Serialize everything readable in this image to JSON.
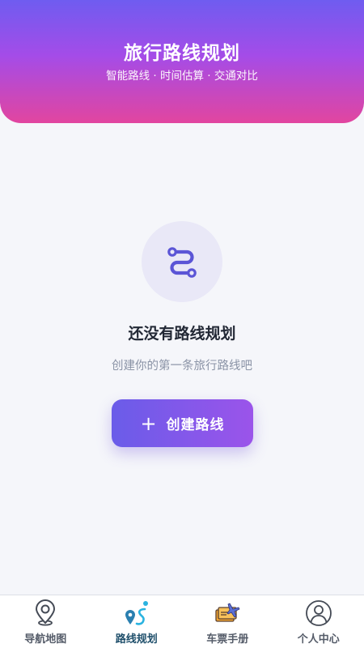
{
  "header": {
    "title": "旅行路线规划",
    "subtitle": "智能路线 · 时间估算 · 交通对比"
  },
  "empty_state": {
    "icon": "route-icon",
    "title": "还没有路线规划",
    "description": "创建你的第一条旅行路线吧"
  },
  "create_button": {
    "icon": "plus-icon",
    "label": "创建路线"
  },
  "tabbar": {
    "active": "路线规划",
    "items": [
      {
        "label": "导航地图",
        "icon": "map-pin-icon"
      },
      {
        "label": "路线规划",
        "icon": "route-pin-icon"
      },
      {
        "label": "车票手册",
        "icon": "ticket-plane-icon"
      },
      {
        "label": "个人中心",
        "icon": "user-icon"
      }
    ]
  },
  "colors": {
    "header_gradient_top": "#6f5cf0",
    "header_gradient_bottom": "#e2459f",
    "button_gradient_start": "#6a5ce9",
    "button_gradient_end": "#9b54ea",
    "background": "#f5f6fa"
  }
}
